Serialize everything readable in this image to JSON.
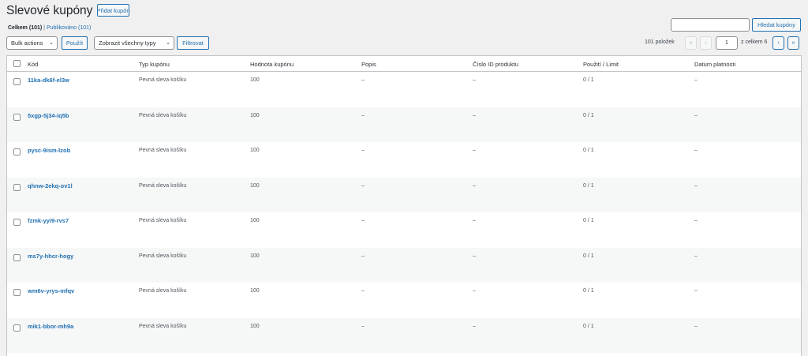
{
  "page": {
    "title": "Slevové kupóny",
    "add_button": "Přidat kupón"
  },
  "views": {
    "all_label": "Celkem",
    "all_count": "(101)",
    "separator": "|",
    "published_label": "Publikováno",
    "published_count": "(101)"
  },
  "search": {
    "value": "",
    "button": "Hledat kupóny"
  },
  "toolbar": {
    "bulk_actions": "Bulk actions",
    "apply": "Použít",
    "types_filter": "Zobrazit všechny typy",
    "filter": "Filtrovat"
  },
  "pagination": {
    "items": "101 položek",
    "first": "«",
    "prev": "‹",
    "current_page": "1",
    "of_total": "z celkem 6",
    "next": "›",
    "last": "»"
  },
  "table": {
    "columns": {
      "code": "Kód",
      "type": "Typ kupónu",
      "amount": "Hodnota kupónu",
      "description": "Popis",
      "product_ids": "Číslo ID produktu",
      "usage": "Použití / Limit",
      "expiry": "Datum platnosti"
    },
    "rows": [
      {
        "code": "11ka-dk6f-el3w",
        "type": "Pevná sleva košíku",
        "amount": "100",
        "description": "–",
        "product_ids": "–",
        "usage": "0 / 1",
        "expiry": "–"
      },
      {
        "code": "5xgp-5j34-iq5b",
        "type": "Pevná sleva košíku",
        "amount": "100",
        "description": "–",
        "product_ids": "–",
        "usage": "0 / 1",
        "expiry": "–"
      },
      {
        "code": "pysc-9ism-lzob",
        "type": "Pevná sleva košíku",
        "amount": "100",
        "description": "–",
        "product_ids": "–",
        "usage": "0 / 1",
        "expiry": "–"
      },
      {
        "code": "qhnw-2ekq-ov1l",
        "type": "Pevná sleva košíku",
        "amount": "100",
        "description": "–",
        "product_ids": "–",
        "usage": "0 / 1",
        "expiry": "–"
      },
      {
        "code": "fzmk-yyi9-rvs7",
        "type": "Pevná sleva košíku",
        "amount": "100",
        "description": "–",
        "product_ids": "–",
        "usage": "0 / 1",
        "expiry": "–"
      },
      {
        "code": "ms7y-hhcr-hogy",
        "type": "Pevná sleva košíku",
        "amount": "100",
        "description": "–",
        "product_ids": "–",
        "usage": "0 / 1",
        "expiry": "–"
      },
      {
        "code": "wm6v-yrys-mfqv",
        "type": "Pevná sleva košíku",
        "amount": "100",
        "description": "–",
        "product_ids": "–",
        "usage": "0 / 1",
        "expiry": "–"
      },
      {
        "code": "mik1-bbor-mh9a",
        "type": "Pevná sleva košíku",
        "amount": "100",
        "description": "–",
        "product_ids": "–",
        "usage": "0 / 1",
        "expiry": "–"
      }
    ]
  },
  "colors": {
    "accent": "#2271b1",
    "background": "#f0f0f1",
    "row_alt": "#f6f7f7"
  }
}
